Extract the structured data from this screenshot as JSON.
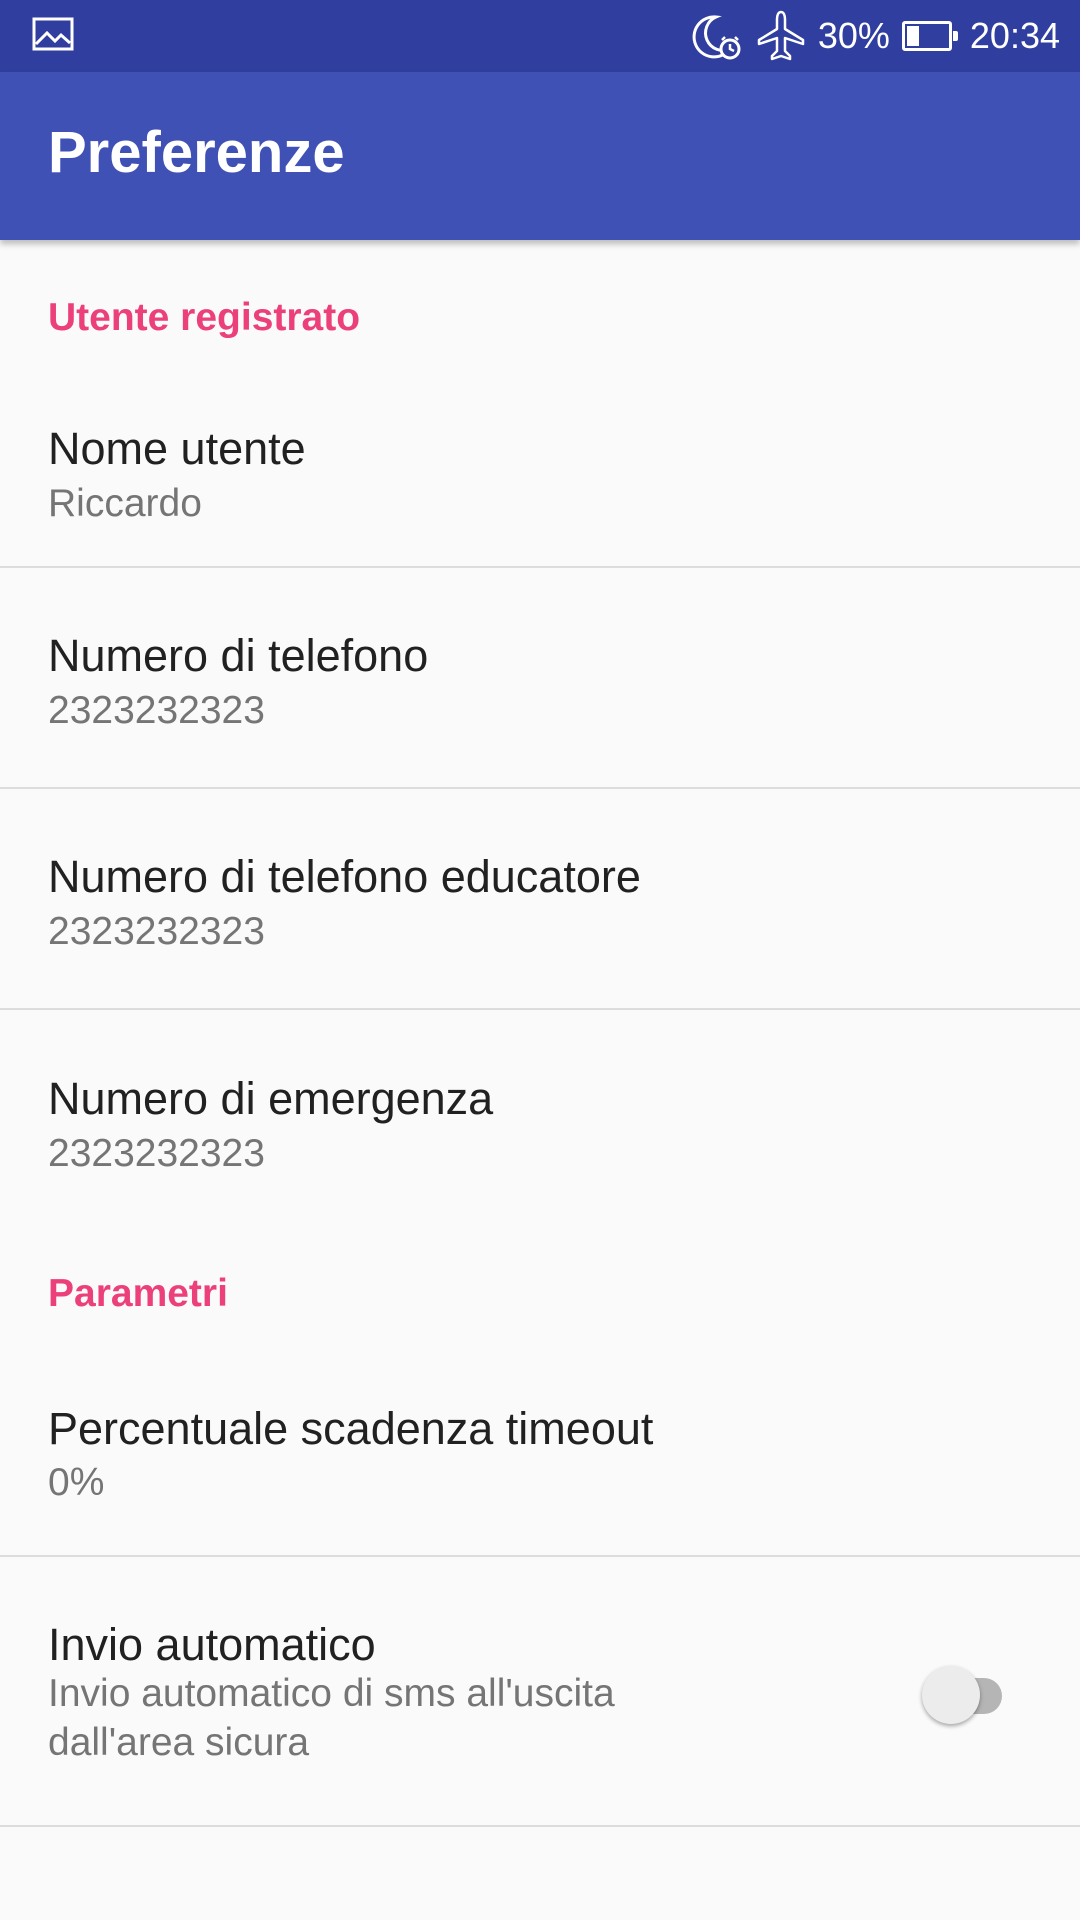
{
  "status_bar": {
    "left_icon": "image-notification-icon",
    "icons": [
      "moon-alarm-icon",
      "airplane-mode-icon"
    ],
    "battery_percent": "30%",
    "battery_level": 0.3,
    "time": "20:34"
  },
  "app_bar": {
    "title": "Preferenze",
    "color": "#3f51b5",
    "status_color": "#303f9f"
  },
  "accent_color": "#ec407a",
  "categories": [
    {
      "title": "Utente registrato",
      "items": [
        {
          "title": "Nome utente",
          "summary": "Riccardo"
        },
        {
          "title": "Numero di telefono",
          "summary": "2323232323"
        },
        {
          "title": "Numero di telefono educatore",
          "summary": "2323232323"
        },
        {
          "title": "Numero di emergenza",
          "summary": "2323232323"
        }
      ]
    },
    {
      "title": "Parametri",
      "items": [
        {
          "title": "Percentuale scadenza timeout",
          "summary": "0%"
        },
        {
          "title": "Invio automatico",
          "summary": "Invio automatico di sms all'uscita dall'area sicura",
          "switch_on": false
        }
      ]
    }
  ]
}
